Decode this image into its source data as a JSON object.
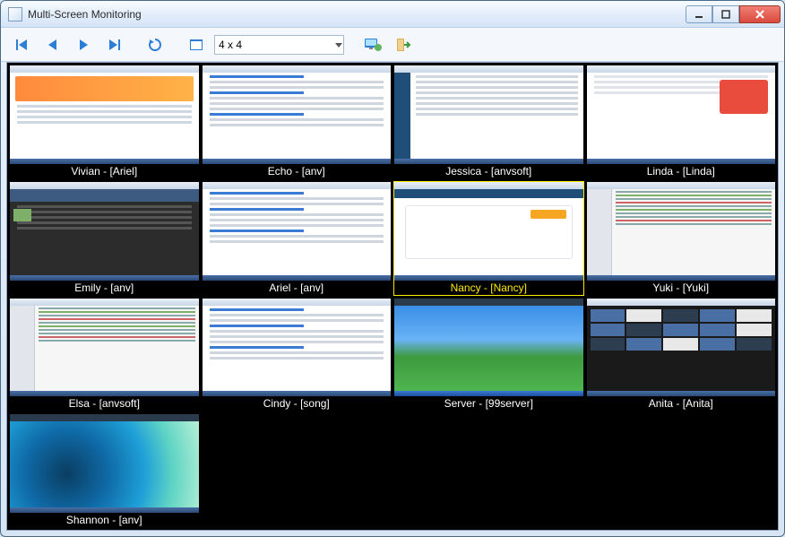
{
  "window": {
    "title": "Multi-Screen Monitoring"
  },
  "toolbar": {
    "layout_value": "4 x 4"
  },
  "screens": [
    {
      "label": "Vivian - [Ariel]",
      "style": "style-browser",
      "selected": false
    },
    {
      "label": "Echo - [anv]",
      "style": "style-text",
      "selected": false
    },
    {
      "label": "Jessica - [anvsoft]",
      "style": "style-list",
      "selected": false
    },
    {
      "label": "Linda - [Linda]",
      "style": "style-red",
      "selected": false
    },
    {
      "label": "Emily - [anv]",
      "style": "style-dark",
      "selected": false
    },
    {
      "label": "Ariel - [anv]",
      "style": "style-text",
      "selected": false
    },
    {
      "label": "Nancy - [Nancy]",
      "style": "style-form",
      "selected": true
    },
    {
      "label": "Yuki - [Yuki]",
      "style": "style-code",
      "selected": false
    },
    {
      "label": "Elsa - [anvsoft]",
      "style": "style-code",
      "selected": false
    },
    {
      "label": "Cindy - [song]",
      "style": "style-text",
      "selected": false
    },
    {
      "label": "Server - [99server]",
      "style": "style-xp",
      "selected": false
    },
    {
      "label": "Anita - [Anita]",
      "style": "style-mosaic",
      "selected": false
    },
    {
      "label": "Shannon - [anv]",
      "style": "style-wave",
      "selected": false
    },
    {
      "label": "",
      "style": "empty",
      "selected": false
    },
    {
      "label": "",
      "style": "empty",
      "selected": false
    },
    {
      "label": "",
      "style": "empty",
      "selected": false
    }
  ]
}
